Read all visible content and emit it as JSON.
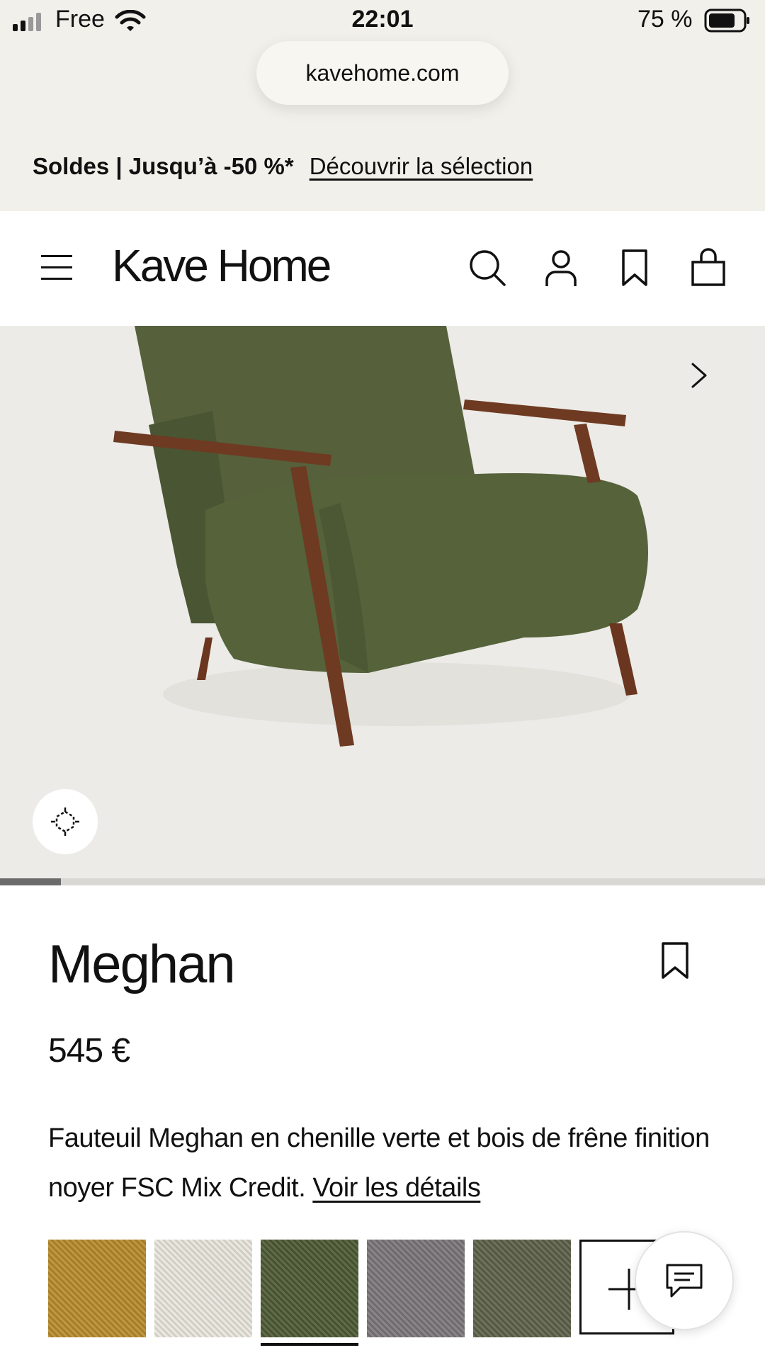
{
  "status_bar": {
    "carrier": "Free",
    "time": "22:01",
    "battery": "75 %"
  },
  "browser": {
    "url": "kavehome.com"
  },
  "promo": {
    "text": "Soldes | Jusqu’à -50 %*",
    "link": "Découvrir la sélection"
  },
  "header": {
    "logo": "Kave Home",
    "icons": [
      "menu-icon",
      "search-icon",
      "account-icon",
      "bookmark-icon",
      "bag-icon"
    ]
  },
  "gallery": {
    "current_image_progress": 0.08,
    "icons": [
      "chevron-right-icon",
      "ar-view-icon"
    ]
  },
  "product": {
    "name": "Meghan",
    "price": "545 €",
    "description": "Fauteuil Meghan en chenille verte et bois de frêne finition noyer FSC Mix Credit.",
    "details_link": "Voir les détails"
  },
  "swatches": {
    "colors": [
      "#b88a2c",
      "#e9e5dc",
      "#4e5a35",
      "#7c7679",
      "#5d6249"
    ],
    "selected_index": 2
  },
  "colors": {
    "accent": "#111111",
    "promo_bg": "#f1f0ea",
    "gallery_bg": "#ecebe7"
  }
}
